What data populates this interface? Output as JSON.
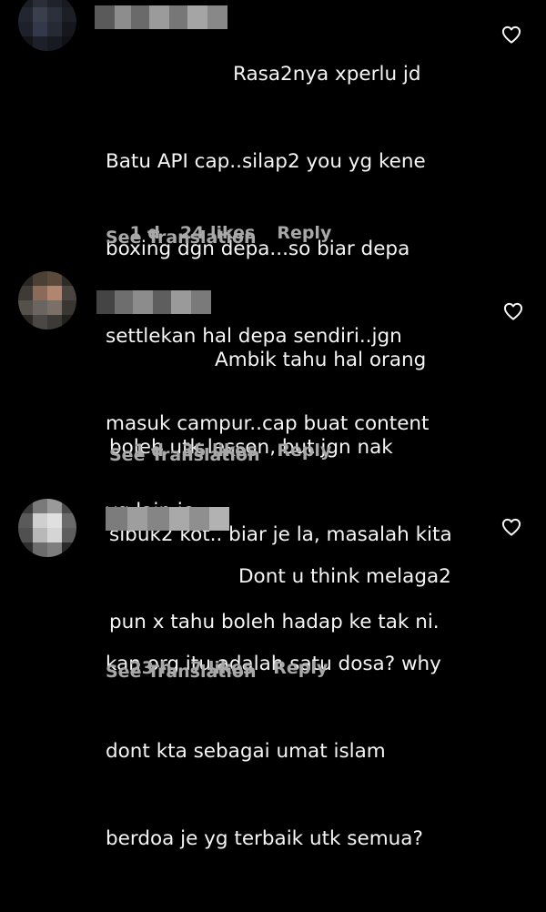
{
  "comments": [
    {
      "text_lines": [
        "Rasa2nya xperlu jd",
        "Batu API cap..silap2 you yg kene",
        "boxing dgn depa...so biar depa",
        "settlekan hal depa sendiri..jgn",
        "masuk campur..cap buat content",
        "yg lain je ..."
      ],
      "time": "1 d",
      "likes": "24 likes",
      "reply_label": "Reply",
      "see_translation": "See Translation",
      "like_icon": "heart-outline-icon"
    },
    {
      "text_lines": [
        "Ambik tahu hal orang",
        "boleh utk lesson, but jgn nak",
        "sibuk2 kot.. biar je la, masalah kita",
        "pun x tahu boleh hadap ke tak ni."
      ],
      "time": "1 d",
      "likes": "35 likes",
      "reply_label": "Reply",
      "see_translation": "See Translation",
      "like_icon": "heart-outline-icon"
    },
    {
      "text_lines": [
        "Dont u think melaga2",
        "kan org itu adalah satu dosa? why",
        "dont kta sebagai umat islam",
        "berdoa je yg terbaik utk semua?"
      ],
      "time": "23 h",
      "likes": "7 likes",
      "reply_label": "Reply",
      "see_translation": "See Translation",
      "like_icon": "heart-outline-icon"
    }
  ],
  "colors": {
    "background": "#000000",
    "comment_text": "#f5f5f5",
    "secondary_text": "#a8a8a8",
    "icon": "#f5f5f5"
  }
}
